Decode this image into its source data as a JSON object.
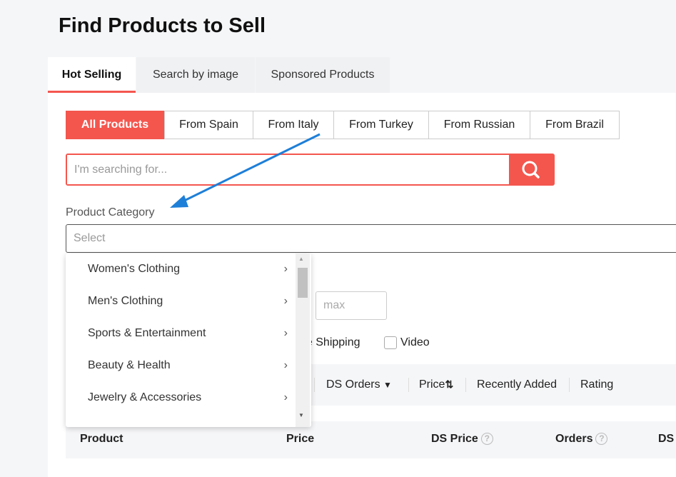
{
  "page_title": "Find Products to Sell",
  "tabs": [
    {
      "label": "Hot Selling",
      "active": true
    },
    {
      "label": "Search by image"
    },
    {
      "label": "Sponsored Products"
    }
  ],
  "origin_filters": [
    {
      "label": "All Products",
      "active": true
    },
    {
      "label": "From Spain"
    },
    {
      "label": "From Italy"
    },
    {
      "label": "From Turkey"
    },
    {
      "label": "From Russian"
    },
    {
      "label": "From Brazil"
    }
  ],
  "search": {
    "placeholder": "I'm searching for...",
    "value": "",
    "icon": "search-icon"
  },
  "category": {
    "label": "Product Category",
    "placeholder": "Select",
    "options": [
      "Women's Clothing",
      "Men's Clothing",
      "Sports & Entertainment",
      "Beauty & Health",
      "Jewelry & Accessories"
    ]
  },
  "price_max_placeholder": "max",
  "checkboxes": {
    "free_shipping": "ee Shipping",
    "video": "Video"
  },
  "sort": {
    "ds_orders": "DS Orders",
    "price": "Price",
    "recently_added": "Recently Added",
    "rating": "Rating"
  },
  "table_headers": {
    "product": "Product",
    "price": "Price",
    "ds_price": "DS Price",
    "orders": "Orders",
    "ds": "DS"
  },
  "colors": {
    "accent": "#f4564e",
    "annotation_arrow": "#1e7fd8"
  }
}
